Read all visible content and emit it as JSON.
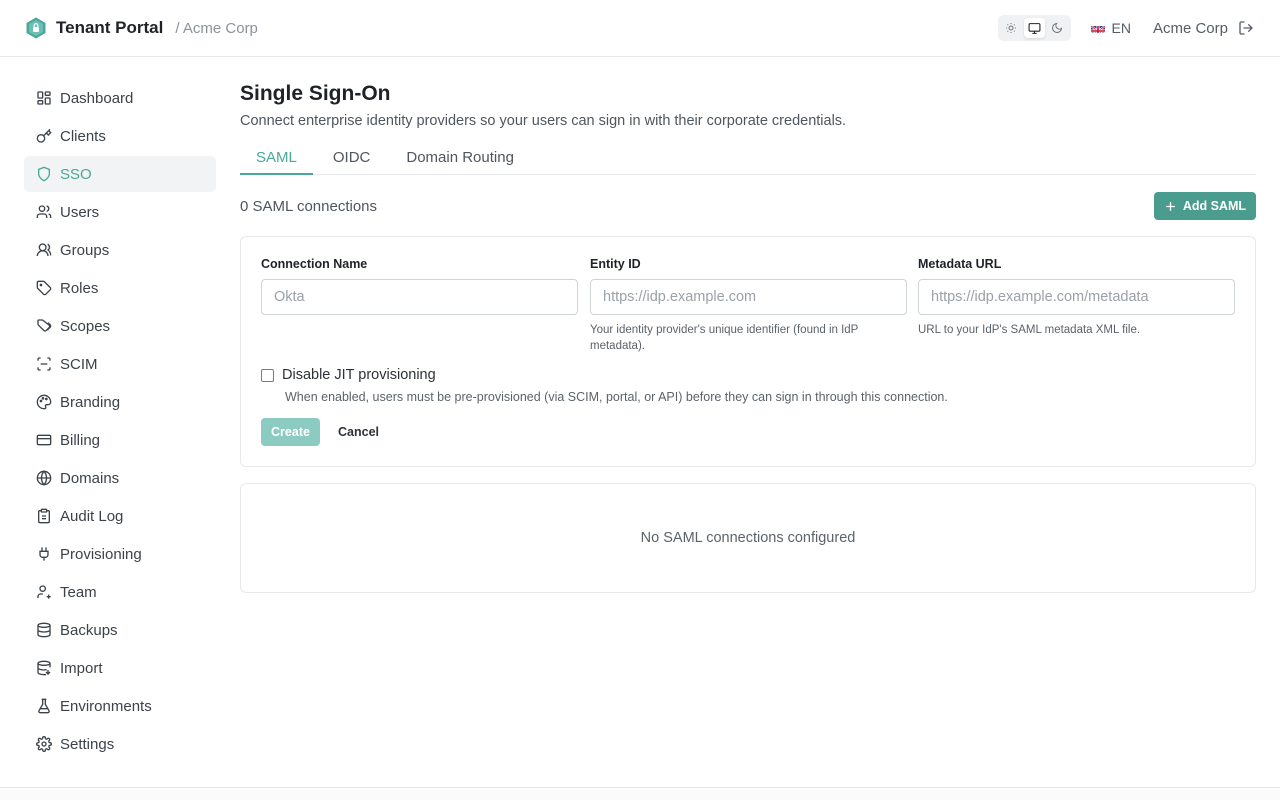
{
  "header": {
    "app_title": "Tenant Portal",
    "breadcrumb": "/ Acme Corp",
    "language": "EN",
    "tenant_name": "Acme Corp",
    "theme_modes": [
      "light",
      "system",
      "dark"
    ],
    "active_theme": "system"
  },
  "sidebar": {
    "items": [
      {
        "label": "Dashboard",
        "icon": "dashboard-icon"
      },
      {
        "label": "Clients",
        "icon": "key-icon"
      },
      {
        "label": "SSO",
        "icon": "shield-icon",
        "active": true
      },
      {
        "label": "Users",
        "icon": "users-icon"
      },
      {
        "label": "Groups",
        "icon": "groups-icon"
      },
      {
        "label": "Roles",
        "icon": "tag-icon"
      },
      {
        "label": "Scopes",
        "icon": "tags-icon"
      },
      {
        "label": "SCIM",
        "icon": "scan-icon"
      },
      {
        "label": "Branding",
        "icon": "palette-icon"
      },
      {
        "label": "Billing",
        "icon": "credit-card-icon"
      },
      {
        "label": "Domains",
        "icon": "globe-icon"
      },
      {
        "label": "Audit Log",
        "icon": "clipboard-icon"
      },
      {
        "label": "Provisioning",
        "icon": "plug-icon"
      },
      {
        "label": "Team",
        "icon": "user-team-icon"
      },
      {
        "label": "Backups",
        "icon": "database-icon"
      },
      {
        "label": "Import",
        "icon": "database-import-icon"
      },
      {
        "label": "Environments",
        "icon": "flask-icon"
      },
      {
        "label": "Settings",
        "icon": "gear-icon"
      }
    ]
  },
  "main": {
    "title": "Single Sign-On",
    "description": "Connect enterprise identity providers so your users can sign in with their corporate credentials.",
    "tabs": [
      {
        "label": "SAML",
        "active": true
      },
      {
        "label": "OIDC"
      },
      {
        "label": "Domain Routing"
      }
    ],
    "count_text": "0 SAML connections",
    "add_button": "Add SAML",
    "form": {
      "connection_name_label": "Connection Name",
      "connection_name_placeholder": "Okta",
      "entity_id_label": "Entity ID",
      "entity_id_placeholder": "https://idp.example.com",
      "entity_id_hint": "Your identity provider's unique identifier (found in IdP metadata).",
      "metadata_url_label": "Metadata URL",
      "metadata_url_placeholder": "https://idp.example.com/metadata",
      "metadata_url_hint": "URL to your IdP's SAML metadata XML file.",
      "jit_label": "Disable JIT provisioning",
      "jit_checked": false,
      "jit_hint": "When enabled, users must be pre-provisioned (via SCIM, portal, or API) before they can sign in through this connection.",
      "create_label": "Create",
      "cancel_label": "Cancel"
    },
    "empty_state": "No SAML connections configured"
  },
  "colors": {
    "accent": "#4aa89a",
    "button": "#4a9c8e",
    "button_disabled": "#8ccbc1"
  }
}
